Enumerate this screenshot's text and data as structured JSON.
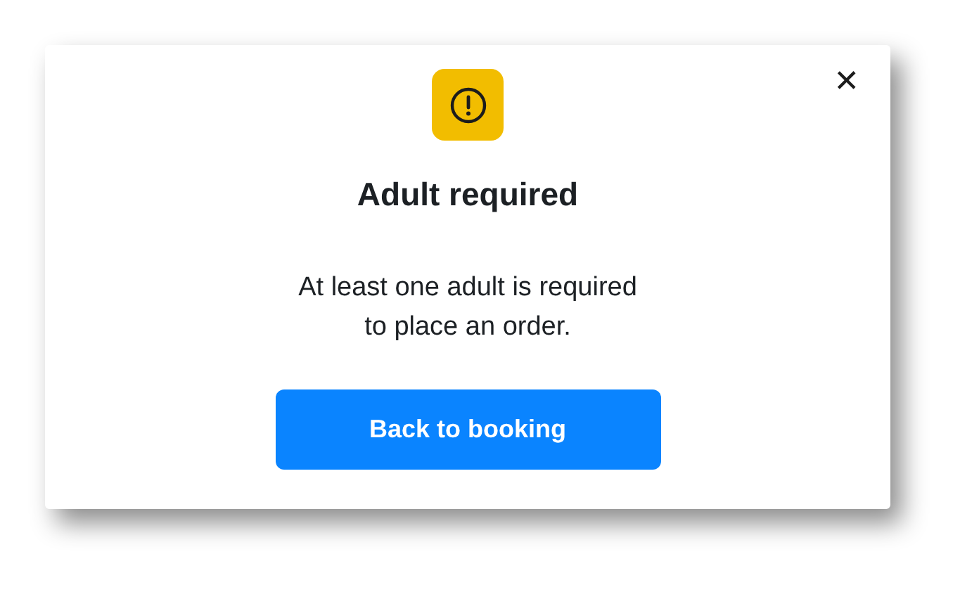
{
  "dialog": {
    "title": "Adult required",
    "message": "At least one adult is required to place an order.",
    "button": "Back to booking",
    "close": "✕"
  }
}
